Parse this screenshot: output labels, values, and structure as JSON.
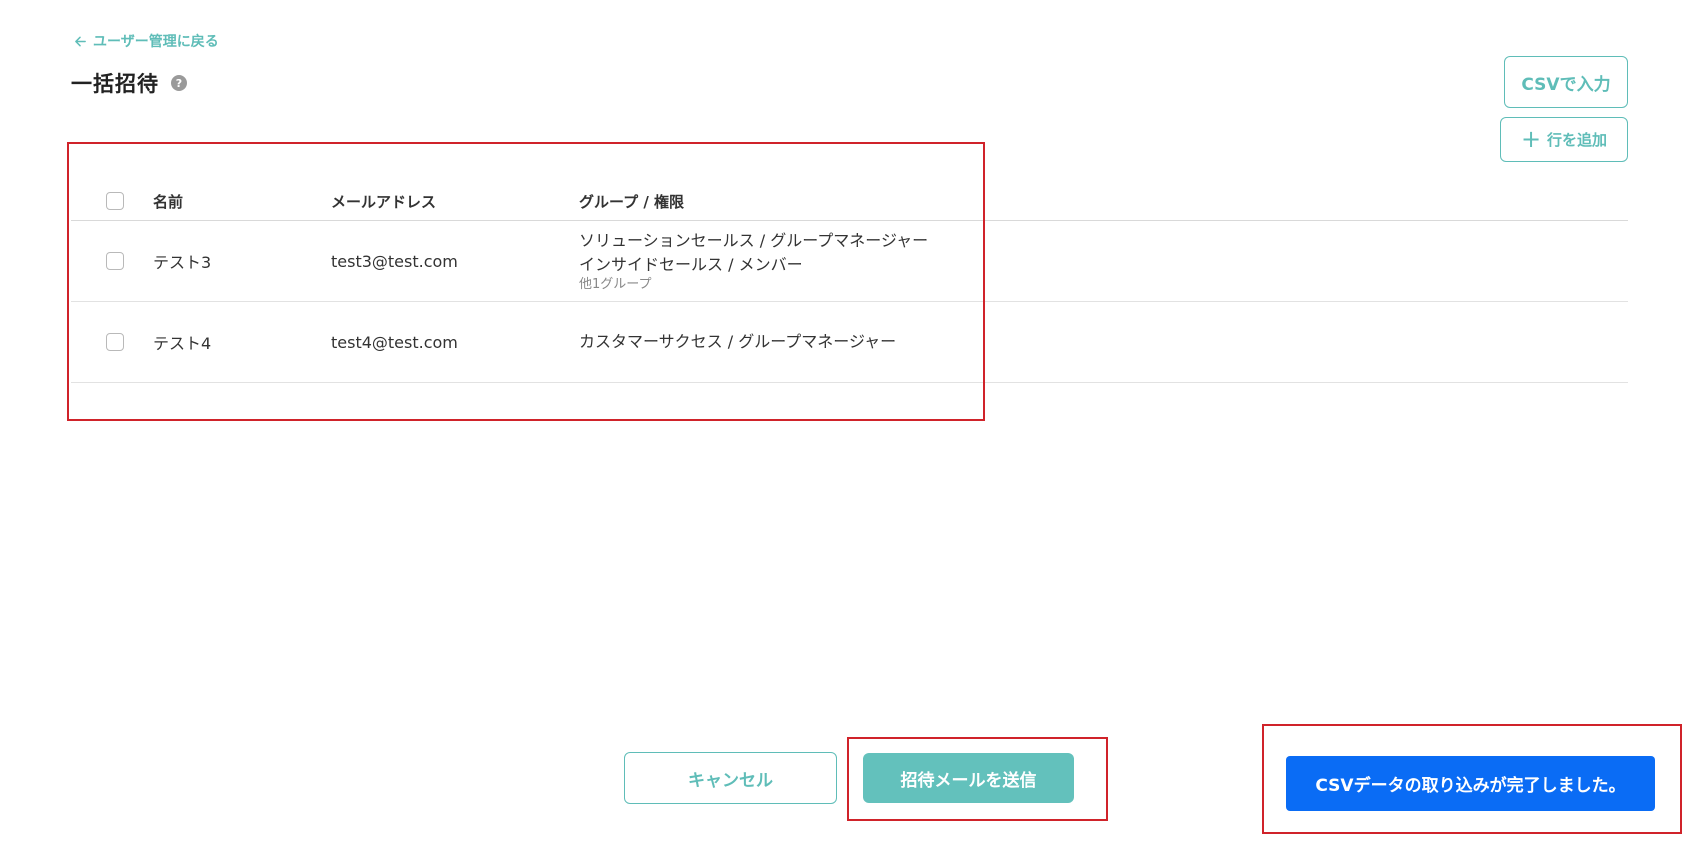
{
  "nav": {
    "back_label": "ユーザー管理に戻る"
  },
  "header": {
    "title": "一括招待",
    "help_glyph": "?"
  },
  "actions": {
    "csv_label": "CSVで入力",
    "add_row_label": "行を追加"
  },
  "table": {
    "headers": {
      "name": "名前",
      "email": "メールアドレス",
      "group": "グループ / 権限"
    },
    "rows": [
      {
        "name": "テスト3",
        "email": "test3@test.com",
        "groups": [
          "ソリューションセールス / グループマネージャー",
          "インサイドセールス / メンバー"
        ],
        "more": "他1グループ"
      },
      {
        "name": "テスト4",
        "email": "test4@test.com",
        "groups": [
          "カスタマーサクセス / グループマネージャー"
        ],
        "more": ""
      }
    ]
  },
  "footer": {
    "cancel_label": "キャンセル",
    "send_label": "招待メールを送信"
  },
  "toast": {
    "message": "CSVデータの取り込みが完了しました。"
  },
  "colors": {
    "accent": "#5fbdb8",
    "toast": "#0a6cf5",
    "highlight": "#d0232a"
  }
}
